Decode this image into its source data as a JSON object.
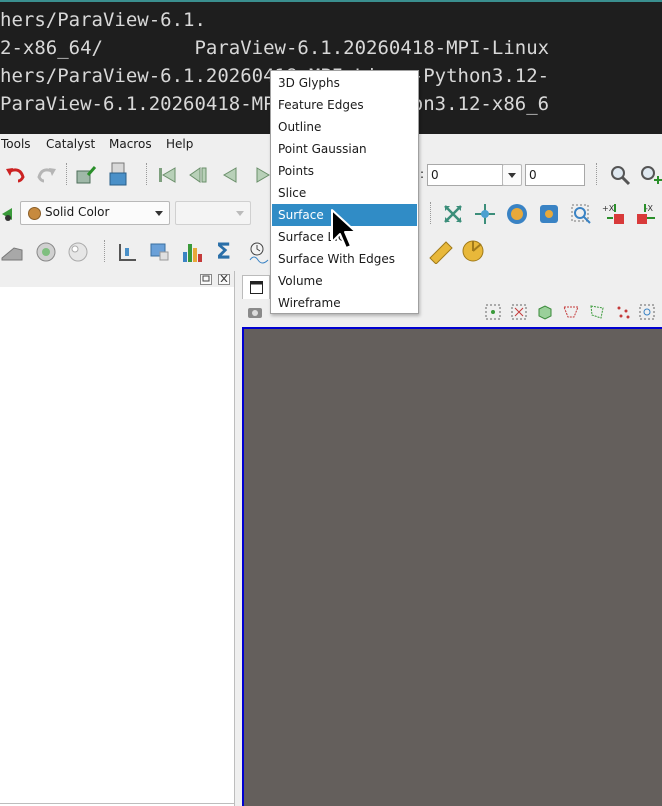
{
  "terminal": {
    "lines": [
      "hers/ParaView-6.1.",
      "2-x86_64/        ParaView-6.1.20260418-MPI-Linux",
      "hers/ParaView-6.1.20260418-MPI-Linux-Python3.12-",
      "ParaView-6.1.20260418-MPI-Linux-Python3.12-x86_6"
    ]
  },
  "menubar": {
    "items": [
      "Tools",
      "Catalyst",
      "Macros",
      "Help"
    ]
  },
  "toolbar": {
    "time_label": ":",
    "time_value": "0",
    "step_value": "0",
    "coloring_value": "Solid Color"
  },
  "representation_menu": {
    "items": [
      "3D Glyphs",
      "Feature Edges",
      "Outline",
      "Point Gaussian",
      "Points",
      "Slice",
      "Surface",
      "Surface LIC",
      "Surface With Edges",
      "Volume",
      "Wireframe"
    ],
    "selected": "Surface"
  },
  "colors": {
    "render_background": "#645f5c",
    "selection": "#308cc6",
    "active_view_border": "#0000d0",
    "terminal_background": "#1e1e1e"
  }
}
